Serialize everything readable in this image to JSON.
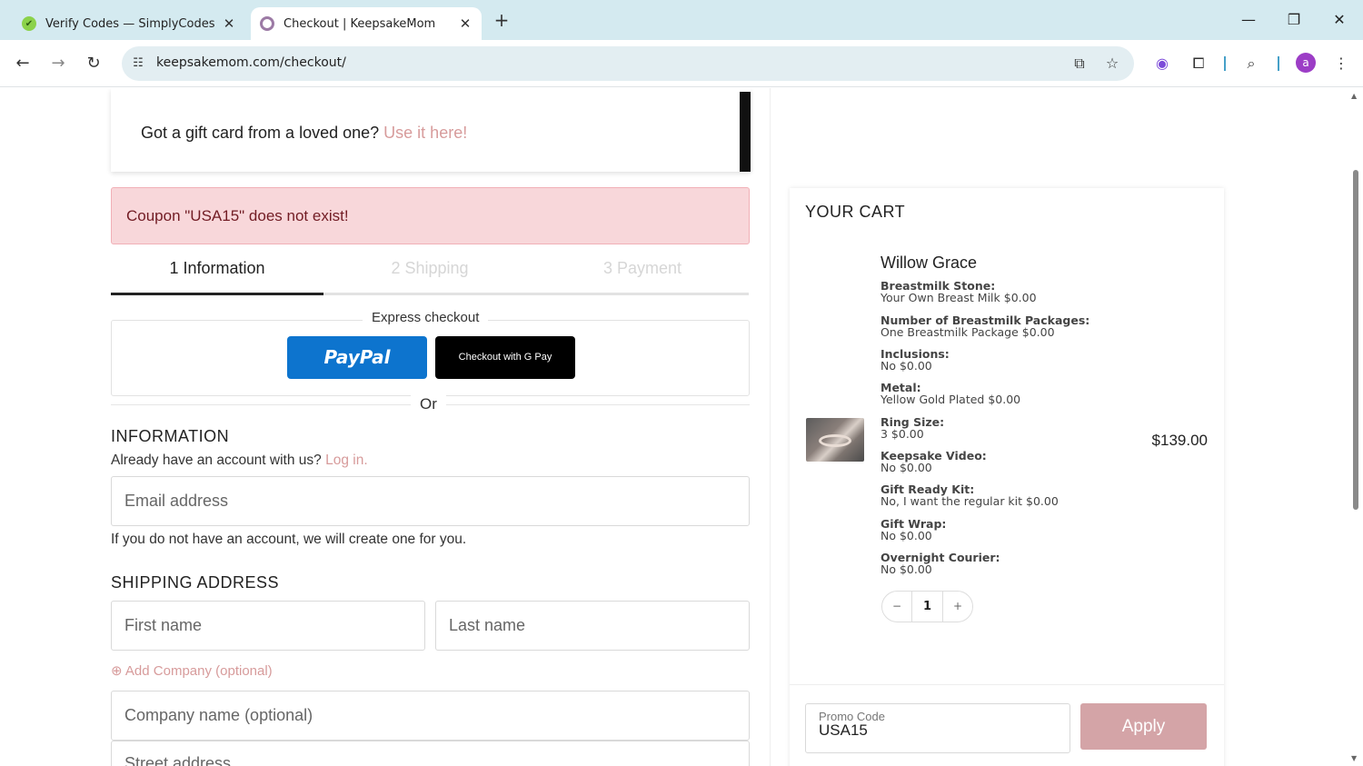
{
  "browser": {
    "tabs": [
      {
        "title": "Verify Codes — SimplyCodes",
        "active": false
      },
      {
        "title": "Checkout | KeepsakeMom",
        "active": true
      }
    ],
    "url": "keepsakemom.com/checkout/",
    "profile_initial": "a"
  },
  "giftcard": {
    "text": "Got a gift card from a loved one?",
    "link": "Use it here!"
  },
  "alert": {
    "message": "Coupon \"USA15\" does not exist!"
  },
  "steps": [
    {
      "label": "1  Information",
      "state": "active"
    },
    {
      "label": "2  Shipping",
      "state": "inactive"
    },
    {
      "label": "3  Payment",
      "state": "inactive"
    }
  ],
  "express": {
    "legend": "Express checkout",
    "paypal": "PayPal",
    "gpay": "Checkout with G Pay",
    "or": "Or"
  },
  "information": {
    "heading": "INFORMATION",
    "account_prompt": "Already have an account with us?",
    "login_link": "Log in.",
    "email_placeholder": "Email address",
    "note": "If you do not have an account, we will create one for you."
  },
  "shipping": {
    "heading": "SHIPPING ADDRESS",
    "first_name_placeholder": "First name",
    "last_name_placeholder": "Last name",
    "add_company": "Add Company (optional)",
    "company_placeholder": "Company name (optional)",
    "street_placeholder": "Street address"
  },
  "cart": {
    "title": "YOUR CART",
    "product": {
      "name": "Willow Grace",
      "price": "$139.00",
      "quantity": "1",
      "options": [
        {
          "label": "Breastmilk Stone:",
          "value": "Your Own Breast Milk $0.00"
        },
        {
          "label": "Number of Breastmilk Packages:",
          "value": "One Breastmilk Package $0.00"
        },
        {
          "label": "Inclusions:",
          "value": "No $0.00"
        },
        {
          "label": "Metal:",
          "value": "Yellow Gold Plated $0.00"
        },
        {
          "label": "Ring Size:",
          "value": "3 $0.00"
        },
        {
          "label": "Keepsake Video:",
          "value": "No $0.00"
        },
        {
          "label": "Gift Ready Kit:",
          "value": "No, I want the regular kit $0.00"
        },
        {
          "label": "Gift Wrap:",
          "value": "No $0.00"
        },
        {
          "label": "Overnight Courier:",
          "value": "No $0.00"
        }
      ]
    },
    "promo": {
      "label": "Promo Code",
      "value": "USA15",
      "apply": "Apply"
    }
  },
  "colors": {
    "accent_pink": "#d79b9b",
    "apply_button": "#d4a4a7",
    "alert_bg": "#f8d7da",
    "paypal_blue": "#0d74ce"
  }
}
